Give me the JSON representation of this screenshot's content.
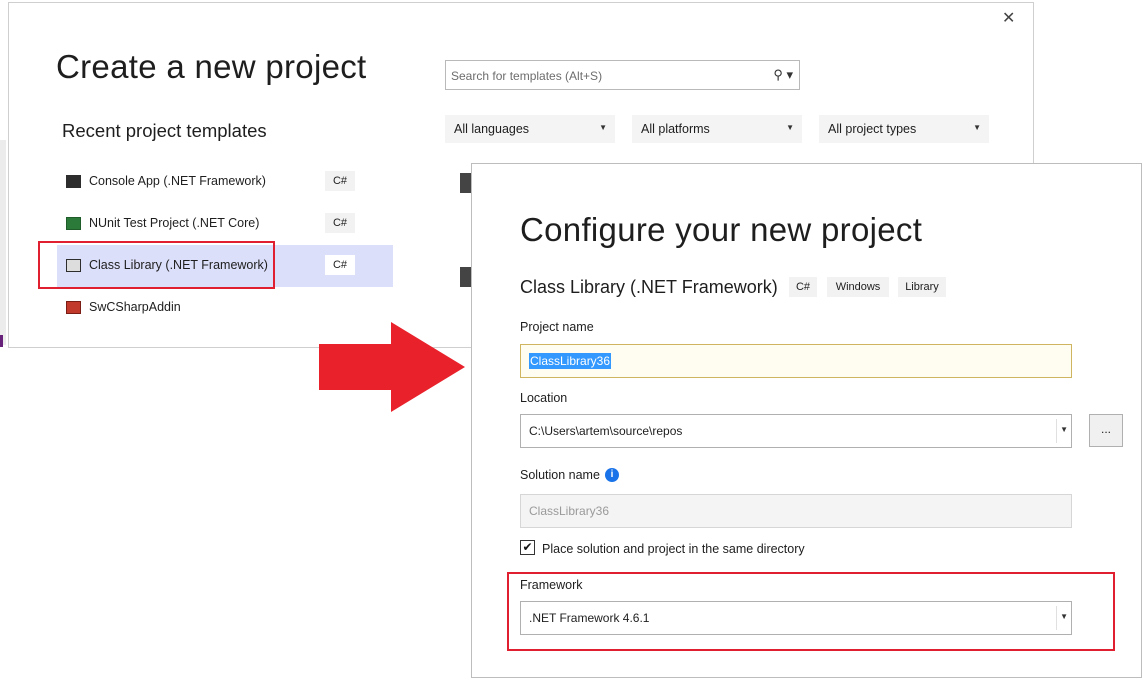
{
  "create_dialog": {
    "title": "Create a new project",
    "close_icon": "close-icon",
    "recent_heading": "Recent project templates",
    "search": {
      "placeholder": "Search for templates (Alt+S)",
      "icon": "search-icon"
    },
    "filters": {
      "languages": "All languages",
      "platforms": "All platforms",
      "project_types": "All project types"
    },
    "recent_templates": [
      {
        "label": "Console App (.NET Framework)",
        "lang": "C#"
      },
      {
        "label": "NUnit Test Project (.NET Core)",
        "lang": "C#"
      },
      {
        "label": "Class Library (.NET Framework)",
        "lang": "C#"
      },
      {
        "label": "SwCSharpAddin",
        "lang": ""
      }
    ]
  },
  "configure_dialog": {
    "title": "Configure your new project",
    "template_name": "Class Library (.NET Framework)",
    "tags": [
      "C#",
      "Windows",
      "Library"
    ],
    "project_name": {
      "label": "Project name",
      "value": "ClassLibrary36"
    },
    "location": {
      "label": "Location",
      "value": "C:\\Users\\artem\\source\\repos",
      "browse_label": "..."
    },
    "solution_name": {
      "label": "Solution name",
      "value": "ClassLibrary36",
      "info_glyph": "i"
    },
    "same_directory": {
      "label": "Place solution and project in the same directory",
      "checked": true,
      "check_glyph": "✔"
    },
    "framework": {
      "label": "Framework",
      "value": ".NET Framework 4.6.1"
    }
  },
  "colors": {
    "highlight": "#e02030",
    "arrow": "#e8212b",
    "selected_row": "#dcdffa",
    "selection": "#3399ff"
  }
}
